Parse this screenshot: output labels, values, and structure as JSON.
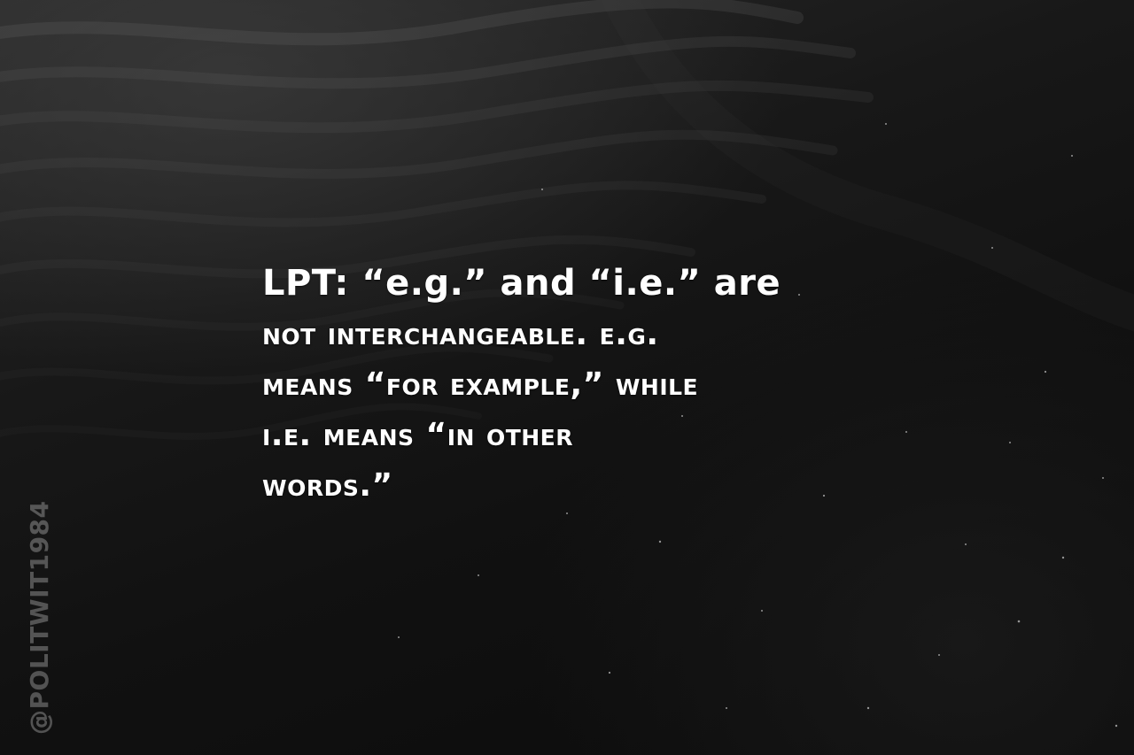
{
  "quote": {
    "lines": [
      "LPT: “e.g.” and “i.e.” are",
      "not interchangeable. e.g.",
      "means “for example,” while",
      "i.e. means “in other",
      "words.”"
    ]
  },
  "watermark": "@POLITWIT1984",
  "colors": {
    "background": "#111111",
    "text": "#ffffff",
    "watermark": "#6b6b6b"
  }
}
